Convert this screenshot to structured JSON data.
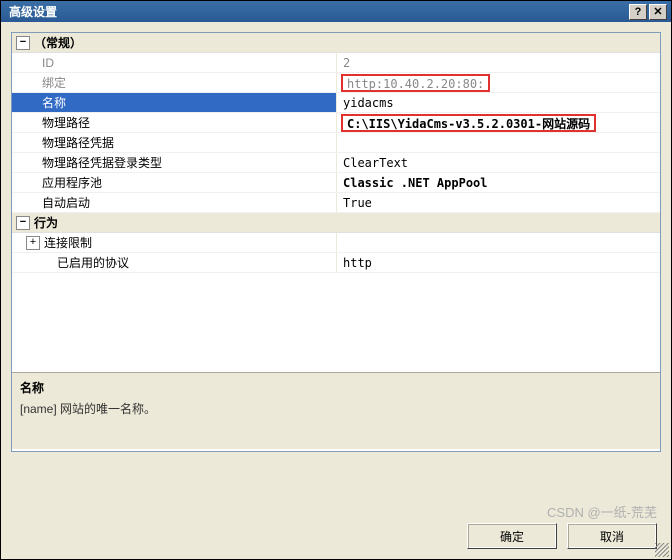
{
  "title": "高级设置",
  "categories": [
    {
      "name": "（常规）",
      "expanded": true,
      "rows": [
        {
          "label": "ID",
          "value": "2",
          "disabled": true
        },
        {
          "label": "绑定",
          "value": "http:10.40.2.20:80:",
          "disabled": true,
          "highlight": true
        },
        {
          "label": "名称",
          "value": "yidacms",
          "selected": true
        },
        {
          "label": "物理路径",
          "value": "C:\\IIS\\YidaCms-v3.5.2.0301-网站源码",
          "bold": true,
          "highlight": true
        },
        {
          "label": "物理路径凭据",
          "value": ""
        },
        {
          "label": "物理路径凭据登录类型",
          "value": "ClearText"
        },
        {
          "label": "应用程序池",
          "value": "Classic .NET AppPool",
          "bold": true
        },
        {
          "label": "自动启动",
          "value": "True"
        }
      ]
    },
    {
      "name": "行为",
      "expanded": true,
      "rows": [
        {
          "label": "连接限制",
          "value": "",
          "hasChildren": true
        },
        {
          "label": "已启用的协议",
          "value": "http",
          "nested": true
        }
      ]
    }
  ],
  "description": {
    "title": "名称",
    "text": "[name] 网站的唯一名称。"
  },
  "buttons": {
    "ok": "确定",
    "cancel": "取消"
  },
  "watermark": "CSDN @一纸-荒芜"
}
